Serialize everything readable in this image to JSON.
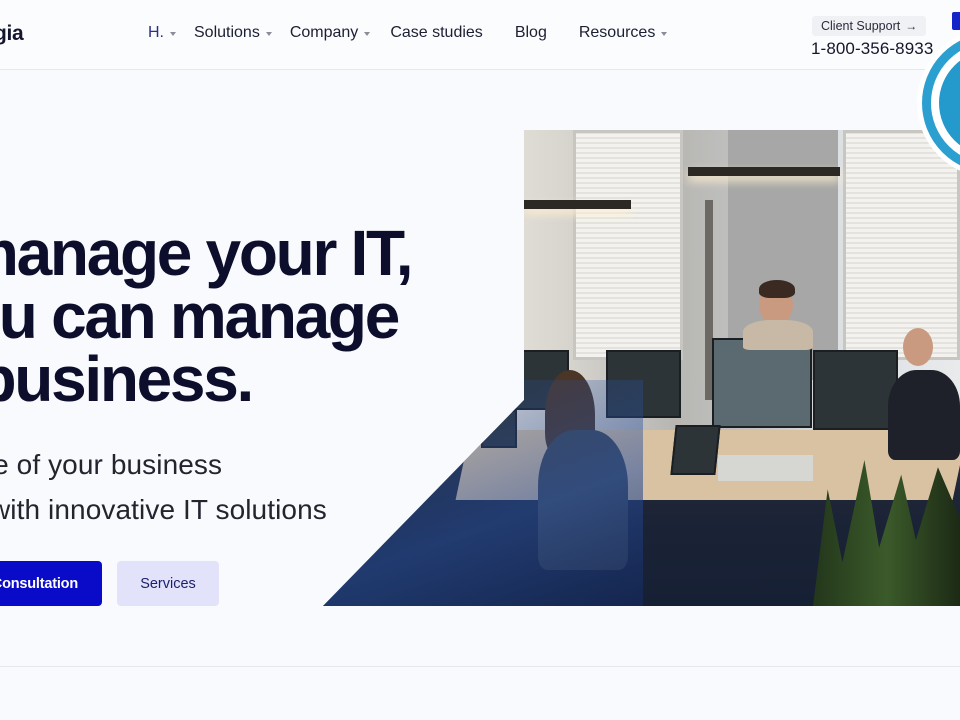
{
  "header": {
    "logo_text": "gia",
    "nav": [
      {
        "label": "H.",
        "has_dropdown": true,
        "active": true
      },
      {
        "label": "Solutions",
        "has_dropdown": true
      },
      {
        "label": "Company",
        "has_dropdown": true
      },
      {
        "label": "Case studies",
        "has_dropdown": false
      },
      {
        "label": "Blog",
        "has_dropdown": false
      },
      {
        "label": "Resources",
        "has_dropdown": true
      }
    ],
    "support_label": "Client Support",
    "support_arrow": "→",
    "phone": "1-800-356-8933"
  },
  "hero": {
    "headline_lines": [
      "manage your IT,",
      "ou can manage",
      " business."
    ],
    "subtext_lines": [
      "rge of your business",
      "y with innovative IT solutions"
    ],
    "primary_button": "Consultation",
    "secondary_button": "Services",
    "image_alt": "office-team-working-at-desks"
  },
  "overlay": {
    "wordpress_logo": "W"
  },
  "colors": {
    "primary": "#0a0bc9",
    "secondary_bg": "#e2e2fa",
    "headline": "#0c0e2c",
    "wp_blue": "#2499cb"
  }
}
